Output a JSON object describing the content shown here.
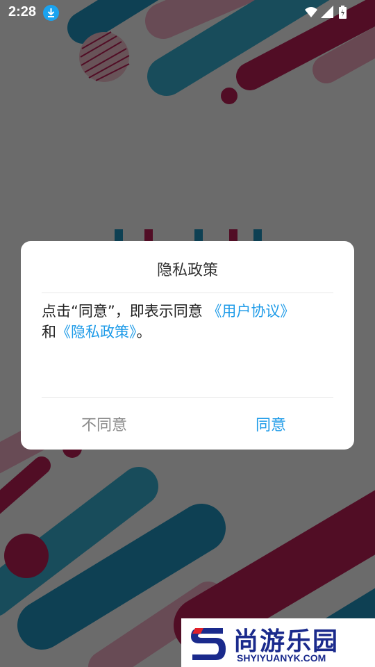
{
  "status_bar": {
    "time": "2:28",
    "icons": [
      "download-icon",
      "wifi-icon",
      "signal-icon",
      "battery-charging-icon"
    ]
  },
  "dialog": {
    "title": "隐私政策",
    "body_prefix": "点击“同意”，即表示同意 ",
    "user_agreement_link": "《用户协议》",
    "body_and": "和",
    "privacy_policy_link": "《隐私政策》",
    "body_suffix": "。",
    "disagree_label": "不同意",
    "agree_label": "同意"
  },
  "watermark": {
    "title": "尚游乐园",
    "subtitle": "SHYIYUANYK.COM"
  },
  "colors": {
    "accent": "#1e9be8",
    "stripe_red": "#b31d53",
    "stripe_blue": "#1f8fb8",
    "overlay": "rgba(0,0,0,0.55)"
  }
}
